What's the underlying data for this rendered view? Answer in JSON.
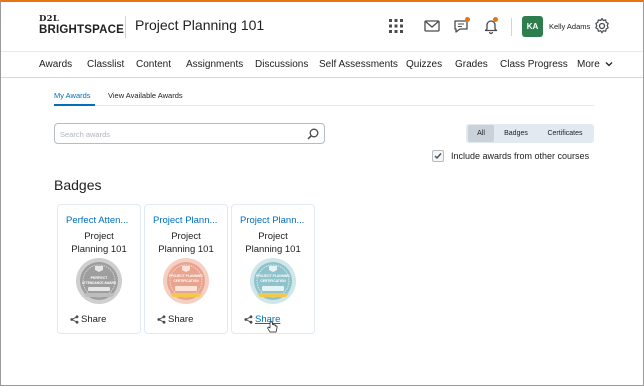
{
  "header": {
    "logo_top": "D2L",
    "logo_bottom": "BRIGHTSPACE",
    "course_title": "Project Planning 101",
    "user_initials": "KA",
    "user_name": "Kelly Adams",
    "icons": [
      "apps-grid-icon",
      "mail-icon",
      "chat-icon",
      "bell-icon",
      "gear-icon"
    ],
    "accent_color": "#e87511"
  },
  "nav": {
    "items": [
      "Awards",
      "Classlist",
      "Content",
      "Assignments",
      "Discussions",
      "Self Assessments",
      "Quizzes",
      "Grades",
      "Class Progress",
      "More"
    ]
  },
  "tabs": {
    "my_awards": "My Awards",
    "view_available": "View Available Awards"
  },
  "search": {
    "placeholder": "Search awards",
    "value": ""
  },
  "filter": {
    "options": [
      "All",
      "Badges",
      "Certificates"
    ],
    "selected": "All"
  },
  "include": {
    "label": "Include awards from other courses",
    "checked": true
  },
  "badges": {
    "heading": "Badges",
    "cards": [
      {
        "title": "Perfect Atten...",
        "course_line1": "Project",
        "course_line2": "Planning 101",
        "seal_text1": "PERFECT",
        "seal_text2": "ATTENDANCE AWARD",
        "share": "Share",
        "color": "#9e9e9e"
      },
      {
        "title": "Project Plann...",
        "course_line1": "Project",
        "course_line2": "Planning 101",
        "seal_text1": "PROJECT PLANNING",
        "seal_text2": "CERTIFICATION",
        "share": "Share",
        "color": "#e8a48e"
      },
      {
        "title": "Project Plann...",
        "course_line1": "Project",
        "course_line2": "Planning 101",
        "seal_text1": "PROJECT PLANNING",
        "seal_text2": "CERTIFICATION",
        "share": "Share",
        "color": "#8fc3cc"
      }
    ]
  }
}
